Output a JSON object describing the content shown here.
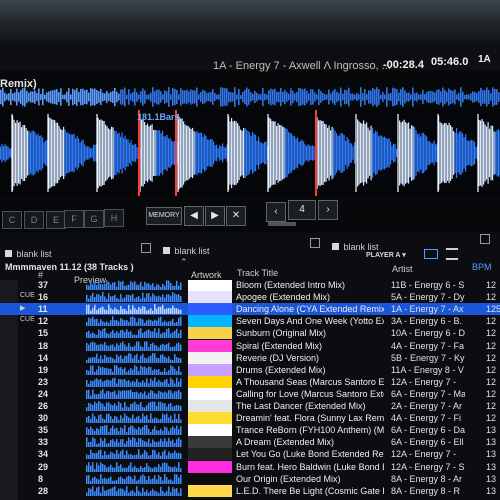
{
  "deck": {
    "title_fragment": "Remix)",
    "track_info": "1A - Energy 7 - Axwell Λ Ingrosso, ...",
    "elapsed": "-00:28.4",
    "remaining": "05:46.0",
    "deck_id": "1A",
    "bars_label": "181.1Bars",
    "hotcues": [
      "C",
      "D",
      "E",
      "F",
      "G",
      "H"
    ],
    "memory_label": "MEMORY",
    "beat_count": "4",
    "icons": [
      "play-icon",
      "next-icon",
      "close-icon",
      "chevron-left-icon",
      "chevron-right-icon"
    ]
  },
  "browser": {
    "tabs": [
      "blank list",
      "blank list",
      "blank list"
    ],
    "player_label": "PLAYER A",
    "list_title": "Mmmmaven 11.12 (38 Tracks )",
    "columns": {
      "num": "#",
      "preview": "Preview",
      "artwork": "Artwork",
      "title": "Track Title",
      "artist": "Artist",
      "bpm": "BPM"
    },
    "rows": [
      {
        "cue": "",
        "num": "37",
        "title": "Bloom (Extended Intro Mix)",
        "artist": "11B - Energy 6 - S",
        "bpm": "12",
        "selected": false
      },
      {
        "cue": "CUE",
        "num": "16",
        "title": "Apogee (Extended Mix)",
        "artist": "5A - Energy 7 - Dy",
        "bpm": "12",
        "selected": false
      },
      {
        "cue": "▶",
        "num": "11",
        "title": "Dancing Alone (CYA Extended Remix)",
        "artist": "1A - Energy 7 - Ax",
        "bpm": "125",
        "selected": true
      },
      {
        "cue": "CUE",
        "num": "12",
        "title": "Seven Days And One Week (Yotto Ext",
        "artist": "3A - Energy 6 - B.",
        "bpm": "12",
        "selected": false
      },
      {
        "cue": "",
        "num": "15",
        "title": "Sunburn (Original Mix)",
        "artist": "10A - Energy 6 - D",
        "bpm": "12",
        "selected": false
      },
      {
        "cue": "",
        "num": "18",
        "title": "Spiral (Extended Mix)",
        "artist": "4A - Energy 7 - Fa",
        "bpm": "12",
        "selected": false
      },
      {
        "cue": "",
        "num": "14",
        "title": "Reverie (DJ Version)",
        "artist": "5B - Energy 7 - Ky",
        "bpm": "12",
        "selected": false
      },
      {
        "cue": "",
        "num": "19",
        "title": "Drums (Extended Mix)",
        "artist": "11A - Energy 8 - V",
        "bpm": "12",
        "selected": false
      },
      {
        "cue": "",
        "num": "23",
        "title": "A Thousand Seas (Marcus Santoro Ex",
        "artist": "12A - Energy 7 -",
        "bpm": "12",
        "selected": false
      },
      {
        "cue": "",
        "num": "24",
        "title": "Calling for Love (Marcus Santoro Exte",
        "artist": "6A - Energy 7 - Ma",
        "bpm": "12",
        "selected": false
      },
      {
        "cue": "",
        "num": "26",
        "title": "The Last Dancer (Extended Mix)",
        "artist": "2A - Energy 7 - Ar",
        "bpm": "12",
        "selected": false
      },
      {
        "cue": "",
        "num": "30",
        "title": "Dreamin' feat. Flora (Sunny Lax Remi",
        "artist": "4A - Energy 7 - Fi",
        "bpm": "12",
        "selected": false
      },
      {
        "cue": "",
        "num": "35",
        "title": "Trance ReBorn (FYH100 Anthem) (Ma",
        "artist": "6A - Energy 6 - Da",
        "bpm": "13",
        "selected": false
      },
      {
        "cue": "",
        "num": "33",
        "title": "A Dream (Extended Mix)",
        "artist": "6A - Energy 6 - Ell",
        "bpm": "13",
        "selected": false
      },
      {
        "cue": "",
        "num": "34",
        "title": "Let You Go (Luke Bond Extended Re",
        "artist": "12A - Energy 7 -",
        "bpm": "13",
        "selected": false
      },
      {
        "cue": "",
        "num": "29",
        "title": "Burn feat. Hero Baldwin (Luke Bond E",
        "artist": "12A - Energy 7 - S",
        "bpm": "13",
        "selected": false
      },
      {
        "cue": "",
        "num": "8",
        "title": "Our Origin (Extended Mix)",
        "artist": "8A - Energy 8 - Ar",
        "bpm": "13",
        "selected": false
      },
      {
        "cue": "",
        "num": "28",
        "title": "L.E.D. There Be Light (Cosmic Gate R",
        "artist": "8A - Energy 8 - R",
        "bpm": "13",
        "selected": false
      }
    ]
  },
  "colors": {
    "waveform": "#2f7dff",
    "waveform_peak": "#cfe3ff",
    "playhead": "#ff3b2f",
    "selection": "#1a56d8",
    "bpm_header": "#4f9bff"
  }
}
